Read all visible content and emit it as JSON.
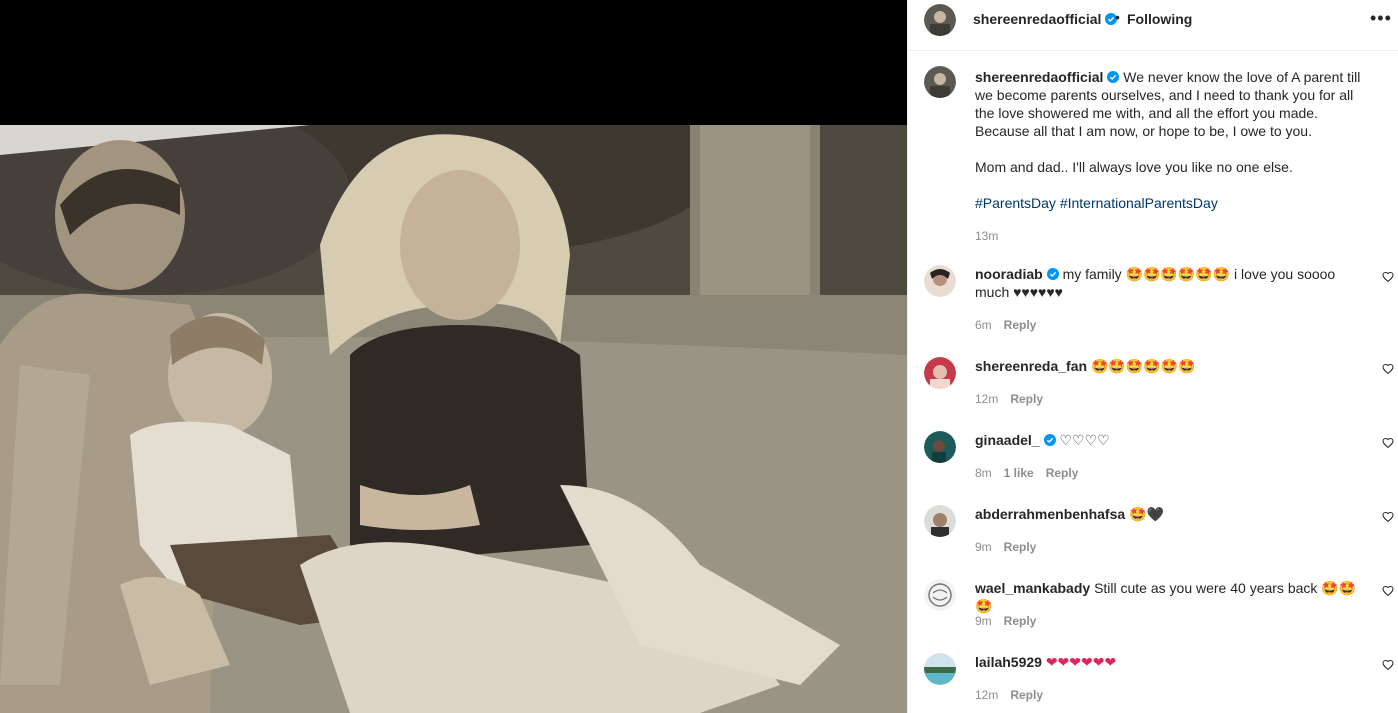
{
  "header": {
    "username": "shereenredaofficial",
    "separator": "•",
    "follow_status": "Following",
    "more_label": "•••"
  },
  "caption": {
    "username": "shereenredaofficial",
    "text": "We never know the love of A parent till we become parents ourselves, and I need to thank you for all the love showered me with, and all the effort you made. Because all that I am now, or hope to be, I owe to you.",
    "line2": "Mom and dad.. I'll always love you like no one else.",
    "hashtags": [
      "#ParentsDay",
      "#InternationalParentsDay"
    ],
    "time": "13m"
  },
  "comments": [
    {
      "username": "nooradiab",
      "verified": true,
      "text": "my family 🤩🤩🤩🤩🤩🤩 i love you soooo much ♥♥♥♥♥♥",
      "time": "6m",
      "likes": "",
      "reply": "Reply"
    },
    {
      "username": "shereenreda_fan",
      "verified": false,
      "text": "🤩🤩🤩🤩🤩🤩",
      "time": "12m",
      "likes": "",
      "reply": "Reply"
    },
    {
      "username": "ginaadel_",
      "verified": true,
      "text": "♡♡♡♡",
      "time": "8m",
      "likes": "1 like",
      "reply": "Reply"
    },
    {
      "username": "abderrahmenbenhafsa",
      "verified": false,
      "text": "🤩🖤",
      "time": "9m",
      "likes": "",
      "reply": "Reply"
    },
    {
      "username": "wael_mankabady",
      "verified": false,
      "text": "Still cute as you were 40 years back 🤩🤩🤩",
      "time": "9m",
      "likes": "",
      "reply": "Reply"
    },
    {
      "username": "lailah5929",
      "verified": false,
      "text": "❤❤❤❤❤❤",
      "time": "12m",
      "likes": "",
      "reply": "Reply"
    }
  ],
  "icons": {
    "verified": "verified-badge-icon",
    "heart": "heart-outline-icon",
    "more": "more-options-icon"
  },
  "colors": {
    "verified_blue": "#0095f6",
    "hashtag": "#00376b",
    "muted_text": "#8e8e8e"
  }
}
